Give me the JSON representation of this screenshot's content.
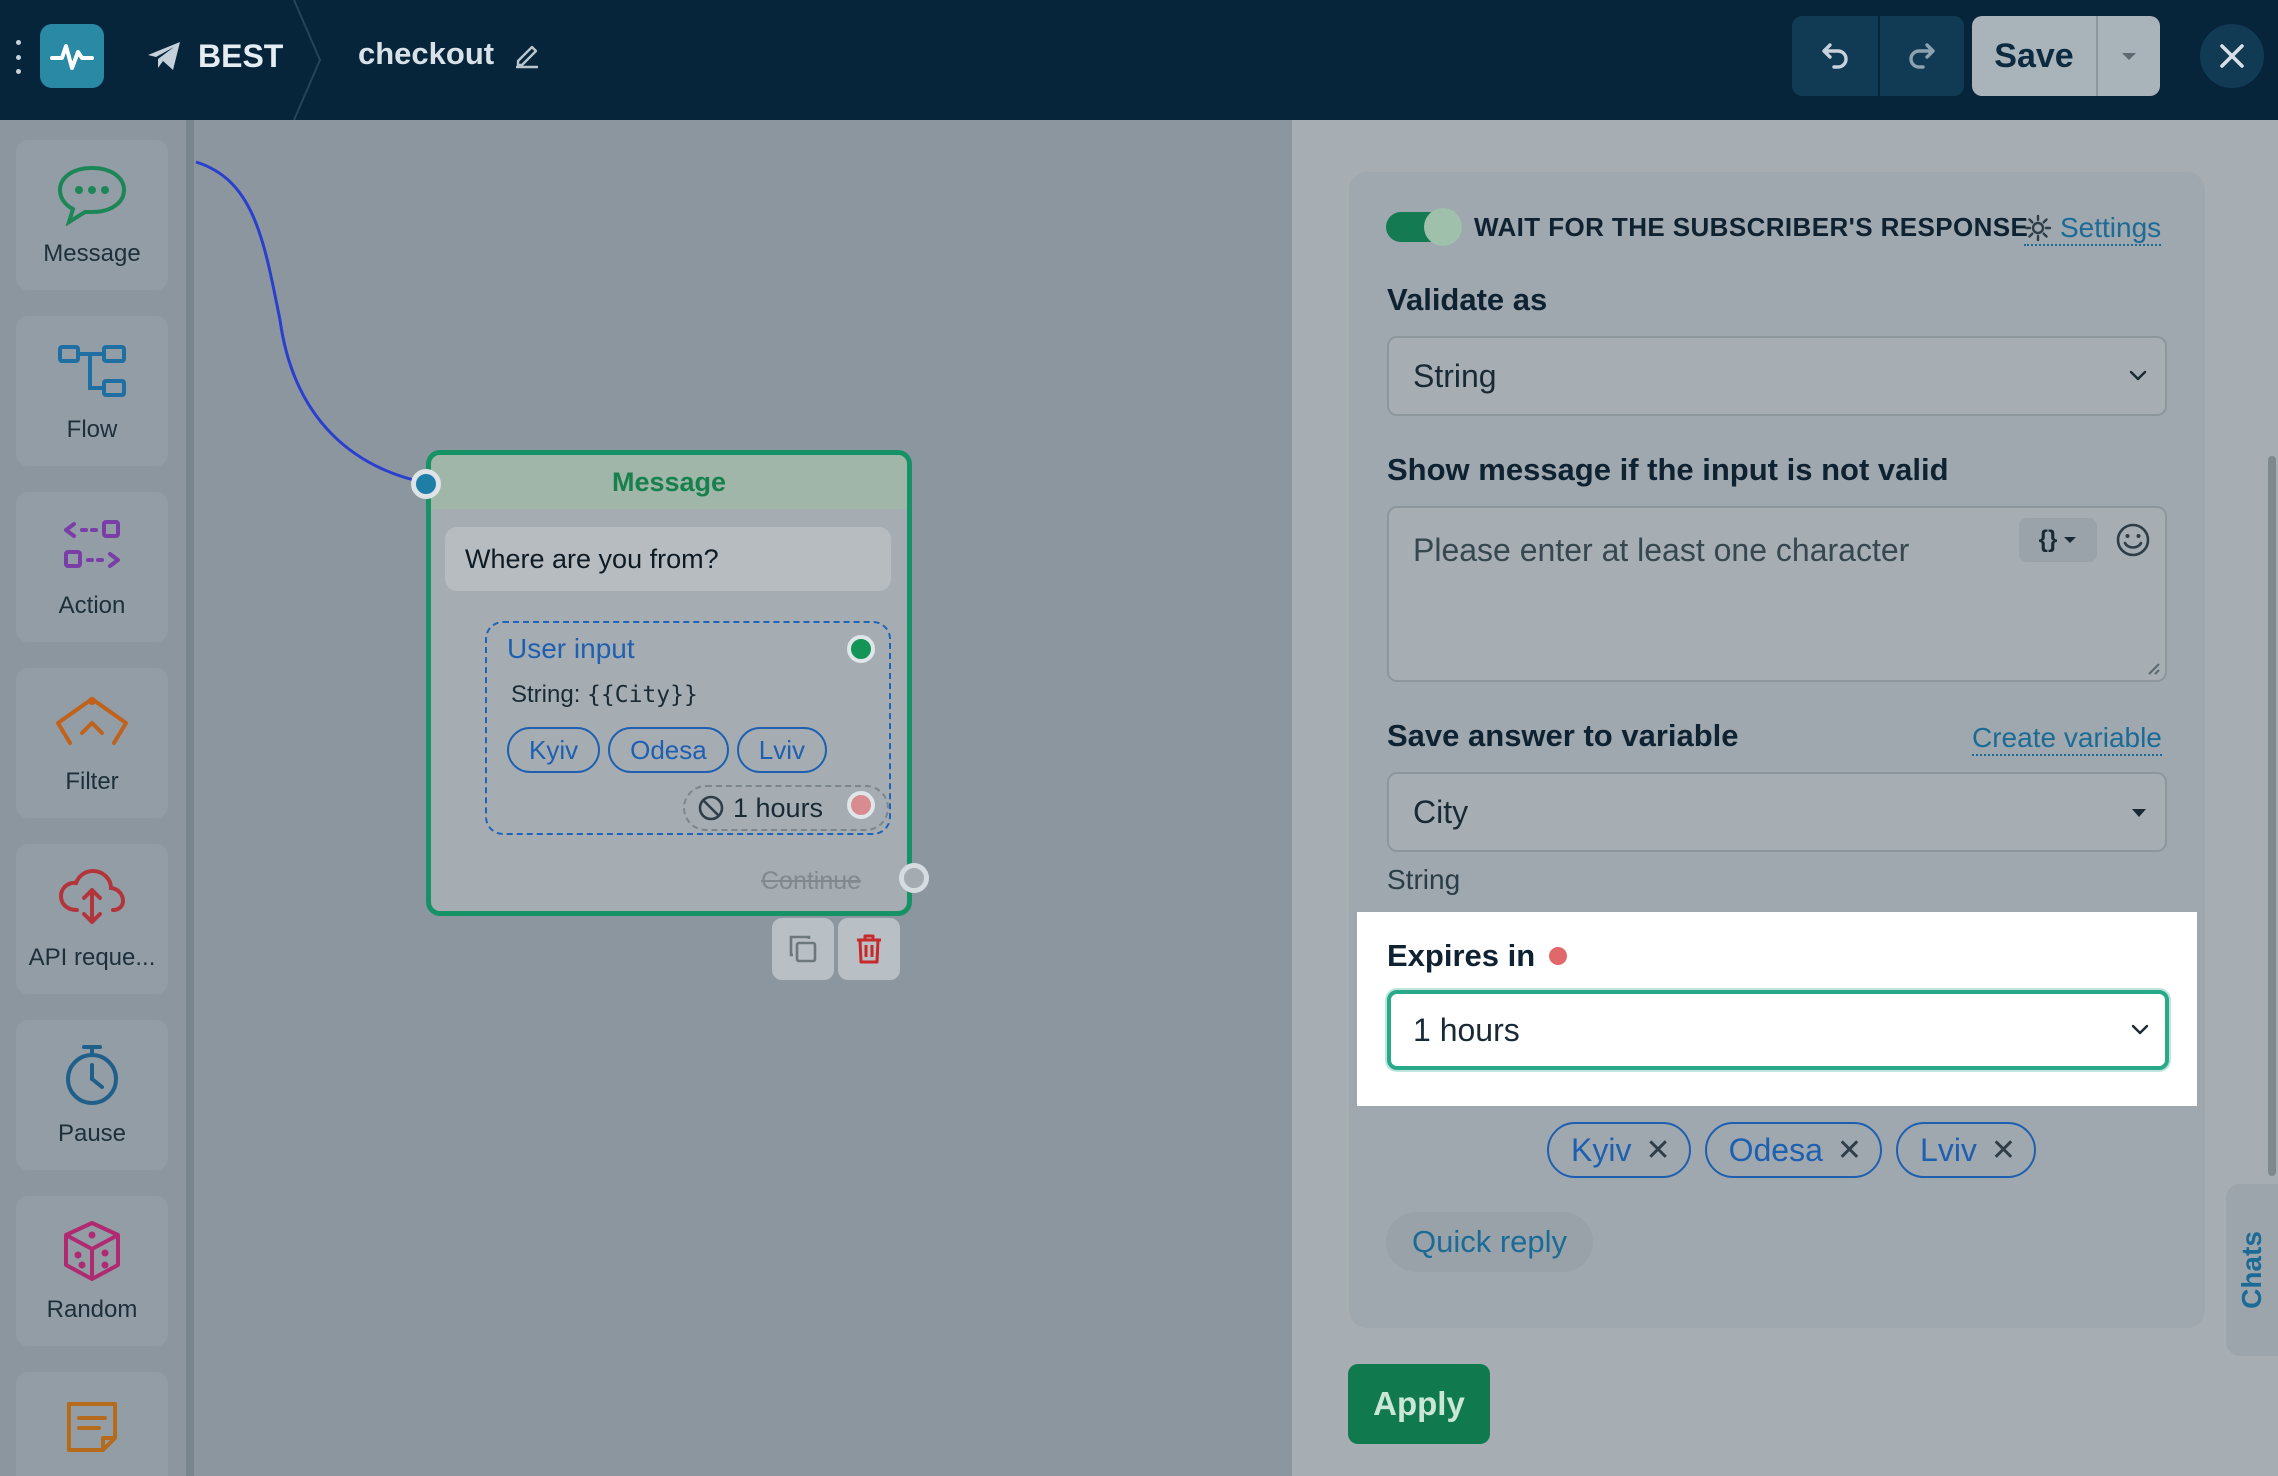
{
  "topbar": {
    "project_name": "BEST",
    "flow_name": "checkout",
    "save_label": "Save"
  },
  "palette": {
    "items": [
      {
        "label": "Message",
        "icon": "chat-bubble-icon"
      },
      {
        "label": "Flow",
        "icon": "flow-icon"
      },
      {
        "label": "Action",
        "icon": "action-icon"
      },
      {
        "label": "Filter",
        "icon": "filter-icon"
      },
      {
        "label": "API reque...",
        "icon": "cloud-api-icon"
      },
      {
        "label": "Pause",
        "icon": "stopwatch-icon"
      },
      {
        "label": "Random",
        "icon": "dice-icon"
      },
      {
        "label": "",
        "icon": "note-icon"
      }
    ]
  },
  "node": {
    "title": "Message",
    "message_text": "Where are you from?",
    "user_input": {
      "title": "User input",
      "type_prefix": "String:",
      "variable": "{{City}}",
      "chips": [
        "Kyiv",
        "Odesa",
        "Lviv"
      ],
      "expire_label": "1 hours"
    },
    "continue_label": "Continue"
  },
  "panel": {
    "wait_label": "WAIT FOR THE SUBSCRIBER'S RESPONSE",
    "settings_label": "Settings",
    "validate_label": "Validate as",
    "validate_value": "String",
    "invalid_msg_label": "Show message if the input is not valid",
    "invalid_msg_placeholder": "Please enter at least one character",
    "var_button": "{}",
    "save_to_label": "Save answer to variable",
    "create_var_label": "Create variable",
    "variable_value": "City",
    "variable_type": "String",
    "expires_label": "Expires in",
    "expires_value": "1 hours",
    "chips": [
      "Kyiv",
      "Odesa",
      "Lviv"
    ],
    "quick_reply_label": "Quick reply",
    "apply_label": "Apply",
    "chats_label": "Chats"
  },
  "colors": {
    "topbar_bg": "#06243a",
    "accent_green": "#107a4e",
    "link_blue": "#1c6b96",
    "chip_blue": "#1f5fb0",
    "focus_teal": "#27a98a",
    "required_red": "#e0686b"
  }
}
